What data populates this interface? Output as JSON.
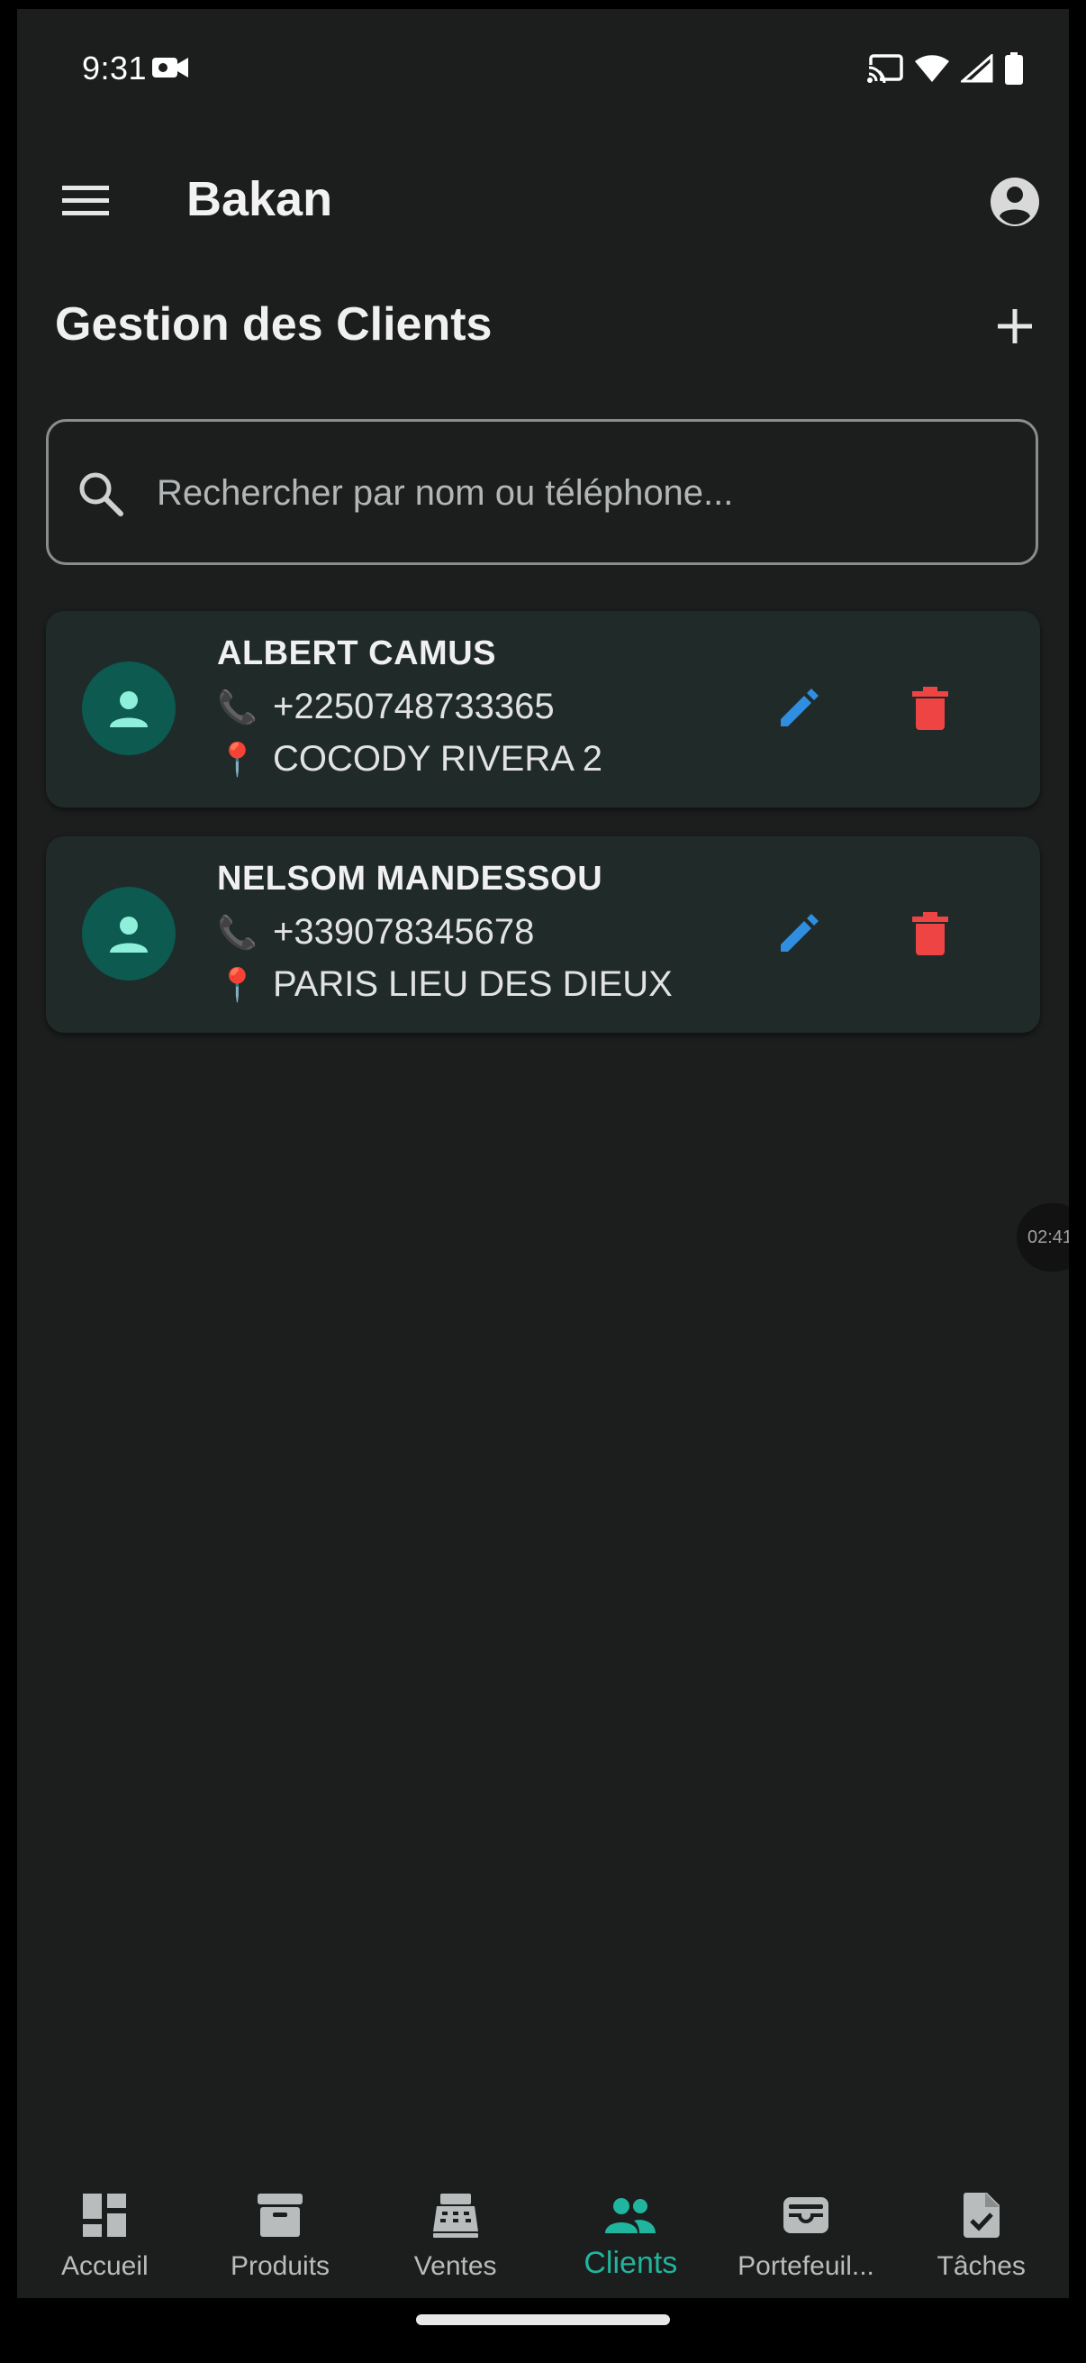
{
  "status_bar": {
    "time": "9:31",
    "icons": [
      "video-camera-icon",
      "cast-icon",
      "wifi-icon",
      "signal-icon",
      "battery-icon"
    ]
  },
  "app_bar": {
    "title": "Bakan",
    "menu_icon": "hamburger-menu-icon",
    "account_icon": "account-circle-icon"
  },
  "page": {
    "title": "Gestion des Clients",
    "add_icon": "plus-icon"
  },
  "search": {
    "placeholder": "Rechercher par nom ou téléphone...",
    "value": ""
  },
  "clients": [
    {
      "name": "ALBERT CAMUS",
      "phone_emoji": "📞",
      "phone": "+2250748733365",
      "address_emoji": "📍",
      "address": "COCODY RIVERA 2"
    },
    {
      "name": "NELSOM MANDESSOU",
      "phone_emoji": "📞",
      "phone": "+339078345678",
      "address_emoji": "📍",
      "address": "PARIS LIEU DES DIEUX"
    }
  ],
  "timer_bubble": "02:41",
  "bottom_nav": {
    "items": [
      {
        "label": "Accueil",
        "icon": "dashboard-icon",
        "active": false
      },
      {
        "label": "Produits",
        "icon": "archive-box-icon",
        "active": false
      },
      {
        "label": "Ventes",
        "icon": "cash-register-icon",
        "active": false
      },
      {
        "label": "Clients",
        "icon": "people-icon",
        "active": true
      },
      {
        "label": "Portefeuil...",
        "icon": "wallet-icon",
        "active": false
      },
      {
        "label": "Tâches",
        "icon": "task-document-icon",
        "active": false
      }
    ]
  },
  "colors": {
    "background": "#1c1d1d",
    "card": "#1f2a29",
    "accent": "#1fb59f",
    "avatar_bg": "#0c5a50",
    "edit": "#2f8ee0",
    "delete": "#ef4444"
  }
}
